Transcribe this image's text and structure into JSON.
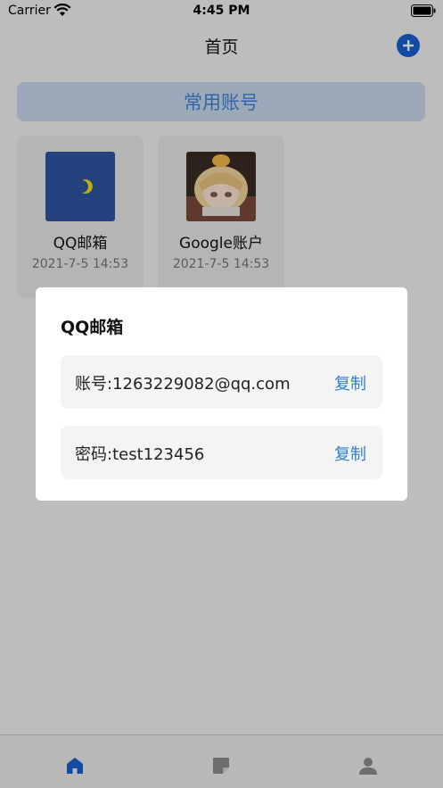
{
  "status_bar": {
    "carrier": "Carrier",
    "time": "4:45 PM"
  },
  "nav": {
    "title": "首页",
    "add_icon": "plus-circle-icon"
  },
  "section": {
    "label": "常用账号"
  },
  "cards": [
    {
      "name": "QQ邮箱",
      "date": "2021-7-5 14:53",
      "thumb": "qq-mail-logo"
    },
    {
      "name": "Google账户",
      "date": "2021-7-5 14:53",
      "thumb": "anime-avatar-image"
    }
  ],
  "dialog": {
    "title": "QQ邮箱",
    "rows": [
      {
        "text": "账号:1263229082@qq.com",
        "action": "复制"
      },
      {
        "text": "密码:test123456",
        "action": "复制"
      }
    ]
  },
  "tabs": [
    {
      "icon": "home-icon",
      "active": true
    },
    {
      "icon": "note-icon",
      "active": false
    },
    {
      "icon": "person-icon",
      "active": false
    }
  ],
  "colors": {
    "accent": "#2f7fd6",
    "tab_active": "#1a5fd0",
    "banner_bg": "#c9d9ee"
  }
}
